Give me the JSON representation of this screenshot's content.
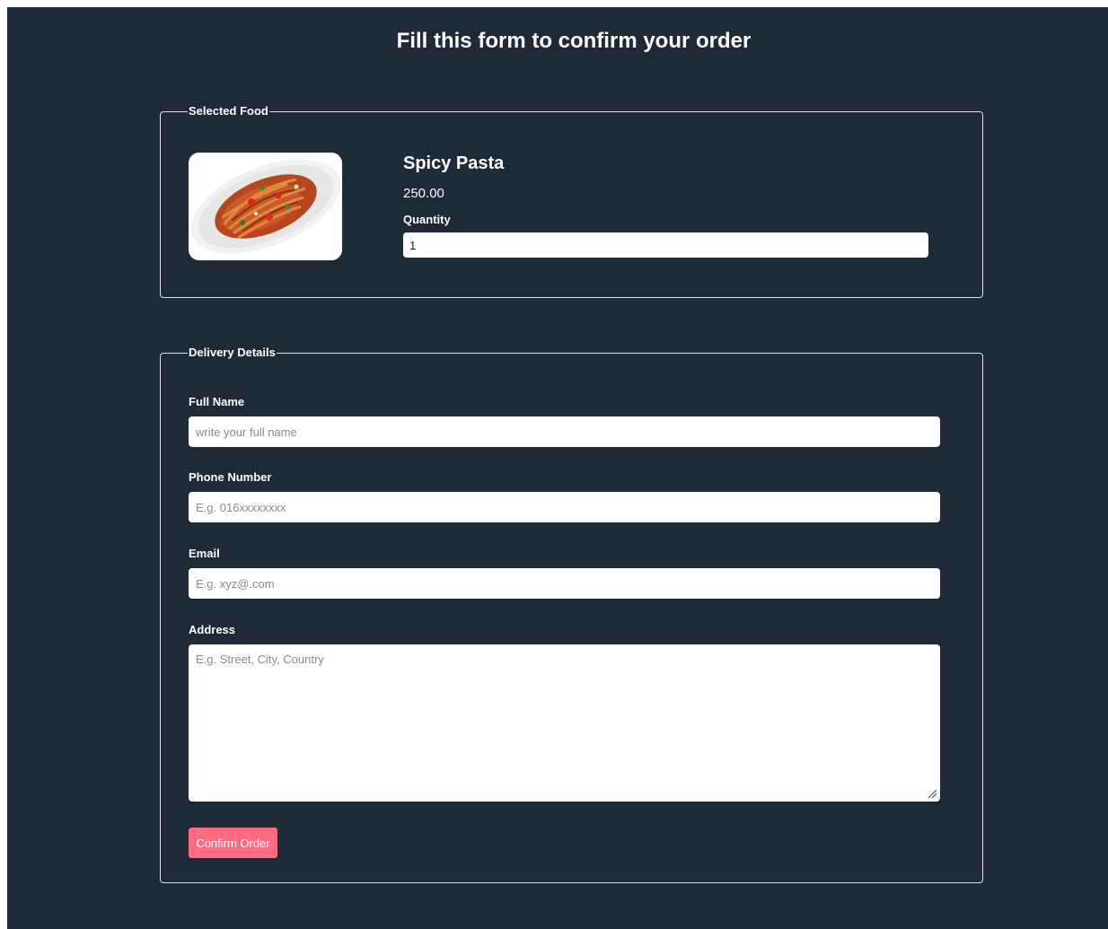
{
  "page": {
    "title": "Fill this form to confirm your order"
  },
  "selected_food": {
    "legend": "Selected Food",
    "name": "Spicy Pasta",
    "price": "250.00",
    "quantity_label": "Quantity",
    "quantity_value": "1",
    "image_icon": "spicy-pasta-photo"
  },
  "delivery": {
    "legend": "Delivery Details",
    "full_name_label": "Full Name",
    "full_name_placeholder": "write your full name",
    "phone_label": "Phone Number",
    "phone_placeholder": "E.g. 016xxxxxxxx",
    "email_label": "Email",
    "email_placeholder": "E.g. xyz@.com",
    "address_label": "Address",
    "address_placeholder": "E.g. Street, City, Country",
    "confirm_label": "Confirm Order"
  },
  "colors": {
    "background": "#1f2a38",
    "accent": "#ff6b81",
    "text": "#ffffff"
  }
}
